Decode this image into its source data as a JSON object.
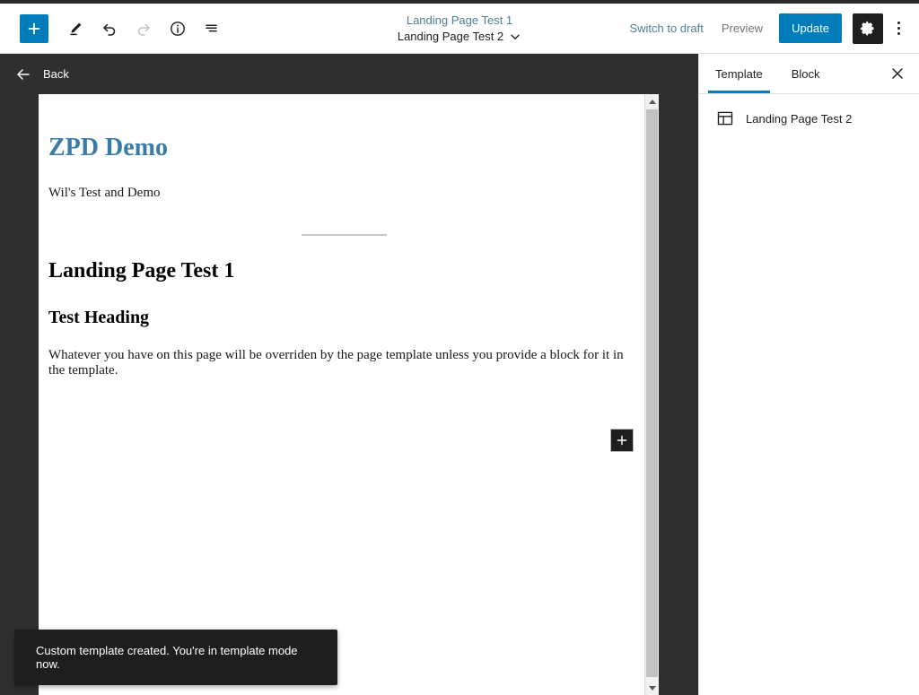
{
  "header": {
    "add_block_tooltip": "Add block",
    "tools_tooltip": "Tools",
    "undo_tooltip": "Undo",
    "redo_tooltip": "Redo",
    "details_tooltip": "Details",
    "list_view_tooltip": "List View",
    "title_top": "Landing Page Test 1",
    "title_bottom": "Landing Page Test 2",
    "switch_to_draft": "Switch to draft",
    "preview": "Preview",
    "update": "Update",
    "settings_tooltip": "Settings",
    "options_tooltip": "Options"
  },
  "back_bar": {
    "label": "Back"
  },
  "canvas": {
    "site_title": "ZPD Demo",
    "tagline": "Wil's Test and Demo",
    "heading_1": "Landing Page Test 1",
    "heading_2": "Test Heading",
    "paragraph": "Whatever you have on this page will be overriden by the page template unless you provide a block for it in the template.",
    "inserter_label": "+"
  },
  "sidebar": {
    "tabs": [
      {
        "label": "Template",
        "active": true
      },
      {
        "label": "Block",
        "active": false
      }
    ],
    "close_label": "Close settings",
    "template_name": "Landing Page Test 2"
  },
  "snackbar": {
    "message": "Custom template created. You're in template mode now."
  },
  "colors": {
    "accent": "#007cba",
    "link": "#4f7e95",
    "dark_bg": "#2f2f2f",
    "title_blue": "#3a7ca8",
    "snackbar_bg": "#1e1e1e"
  }
}
